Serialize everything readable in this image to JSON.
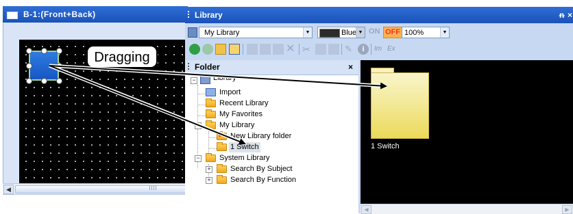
{
  "editor": {
    "title": "B-1:(Front+Back)",
    "callout": "Dragging"
  },
  "library": {
    "title": "Library",
    "pin_glyph": "ᵰ",
    "close_glyph": "×",
    "toolbar": {
      "library_select": "My Library",
      "color_select": "Blue",
      "on_label": "ON",
      "off_label": "OFF",
      "zoom_select": "100%",
      "im_label": "Im",
      "ex_label": "Ex"
    },
    "folder_pane": {
      "title": "Folder",
      "close_glyph": "×",
      "tree": [
        {
          "label": "Library",
          "level": 0,
          "expander": "−"
        },
        {
          "label": "Import",
          "level": 1
        },
        {
          "label": "Recent Library",
          "level": 1
        },
        {
          "label": "My Favorites",
          "level": 1
        },
        {
          "label": "My Library",
          "level": 1,
          "expander": "−"
        },
        {
          "label": "New Library folder",
          "level": 2
        },
        {
          "label": "1 Switch",
          "level": 2,
          "selected": true
        },
        {
          "label": "System Library",
          "level": 1,
          "expander": "−"
        },
        {
          "label": "Search By Subject",
          "level": 2,
          "expander": "+"
        },
        {
          "label": "Search By Function",
          "level": 2,
          "expander": "+"
        }
      ]
    },
    "contents": {
      "item_label": "1 Switch"
    }
  },
  "colors": {
    "title_bar": "#1f5cc6",
    "toolbar_bg": "#c7d8f2",
    "canvas_bg": "#000000",
    "switch_fill": "#1f66d1",
    "off_button": "#ffb24f"
  }
}
